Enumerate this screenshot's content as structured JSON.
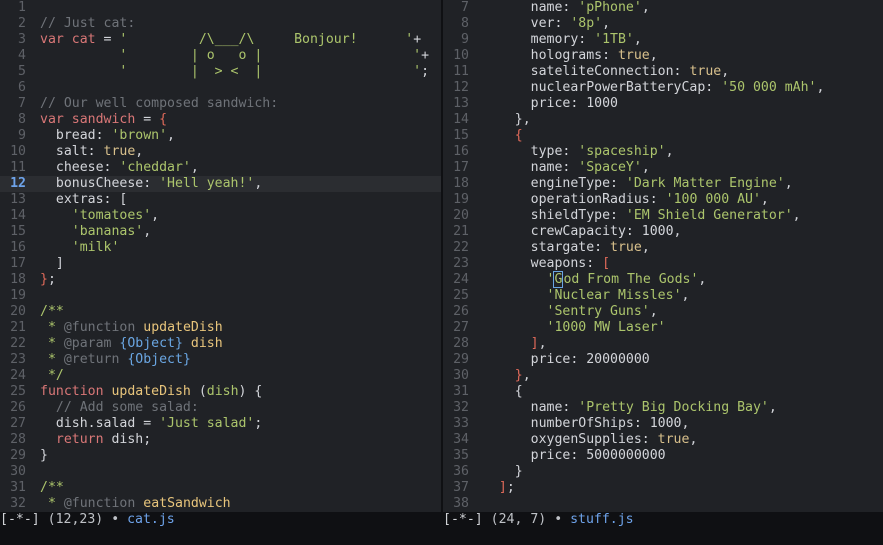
{
  "left_pane": {
    "lines": [
      {
        "n": "1",
        "parts": [
          {
            "t": ""
          }
        ]
      },
      {
        "n": "2",
        "parts": [
          {
            "t": "// Just cat:",
            "c": "c"
          }
        ]
      },
      {
        "n": "3",
        "parts": [
          {
            "t": "var ",
            "c": "k"
          },
          {
            "t": "cat",
            "c": "k"
          },
          {
            "t": " = "
          },
          {
            "t": "'         /\\___/\\     Bonjour!      '",
            "c": "s"
          },
          {
            "t": "+"
          }
        ]
      },
      {
        "n": "4",
        "parts": [
          {
            "t": "          "
          },
          {
            "t": "'        | o   o |                   '",
            "c": "s"
          },
          {
            "t": "+"
          }
        ]
      },
      {
        "n": "5",
        "parts": [
          {
            "t": "          "
          },
          {
            "t": "'        |  > <  |                   '",
            "c": "s"
          },
          {
            "t": ";"
          }
        ]
      },
      {
        "n": "6",
        "parts": [
          {
            "t": ""
          }
        ]
      },
      {
        "n": "7",
        "parts": [
          {
            "t": "// Our well composed sandwich:",
            "c": "c"
          }
        ]
      },
      {
        "n": "8",
        "parts": [
          {
            "t": "var ",
            "c": "k"
          },
          {
            "t": "sandwich",
            "c": "k"
          },
          {
            "t": " = "
          },
          {
            "t": "{",
            "c": "br"
          }
        ]
      },
      {
        "n": "9",
        "parts": [
          {
            "t": "  bread: "
          },
          {
            "t": "'brown'",
            "c": "s"
          },
          {
            "t": ","
          }
        ]
      },
      {
        "n": "10",
        "parts": [
          {
            "t": "  salt: "
          },
          {
            "t": "true",
            "c": "kw"
          },
          {
            "t": ","
          }
        ]
      },
      {
        "n": "11",
        "parts": [
          {
            "t": "  cheese: "
          },
          {
            "t": "'cheddar'",
            "c": "s"
          },
          {
            "t": ","
          }
        ]
      },
      {
        "n": "12",
        "cur": true,
        "parts": [
          {
            "t": "  bonusCheese: "
          },
          {
            "t": "'Hell yeah!'",
            "c": "s"
          },
          {
            "t": ","
          }
        ]
      },
      {
        "n": "13",
        "parts": [
          {
            "t": "  extras: ["
          }
        ]
      },
      {
        "n": "14",
        "parts": [
          {
            "t": "    "
          },
          {
            "t": "'tomatoes'",
            "c": "s"
          },
          {
            "t": ","
          }
        ]
      },
      {
        "n": "15",
        "parts": [
          {
            "t": "    "
          },
          {
            "t": "'bananas'",
            "c": "s"
          },
          {
            "t": ","
          }
        ]
      },
      {
        "n": "16",
        "parts": [
          {
            "t": "    "
          },
          {
            "t": "'milk'",
            "c": "s"
          }
        ]
      },
      {
        "n": "17",
        "parts": [
          {
            "t": "  ]"
          }
        ]
      },
      {
        "n": "18",
        "parts": [
          {
            "t": "}",
            "c": "br"
          },
          {
            "t": ";"
          }
        ]
      },
      {
        "n": "19",
        "parts": [
          {
            "t": ""
          }
        ]
      },
      {
        "n": "20",
        "parts": [
          {
            "t": "/**",
            "c": "doc"
          }
        ]
      },
      {
        "n": "21",
        "parts": [
          {
            "t": " * ",
            "c": "doc"
          },
          {
            "t": "@function",
            "c": "c"
          },
          {
            "t": " "
          },
          {
            "t": "updateDish",
            "c": "fn"
          }
        ]
      },
      {
        "n": "22",
        "parts": [
          {
            "t": " * ",
            "c": "doc"
          },
          {
            "t": "@param",
            "c": "c"
          },
          {
            "t": " "
          },
          {
            "t": "{Object}",
            "c": "ty"
          },
          {
            "t": " dish",
            "c": "fn"
          }
        ]
      },
      {
        "n": "23",
        "parts": [
          {
            "t": " * ",
            "c": "doc"
          },
          {
            "t": "@return",
            "c": "c"
          },
          {
            "t": " "
          },
          {
            "t": "{Object}",
            "c": "ty"
          }
        ]
      },
      {
        "n": "24",
        "parts": [
          {
            "t": " */",
            "c": "doc"
          }
        ]
      },
      {
        "n": "25",
        "parts": [
          {
            "t": "function ",
            "c": "k"
          },
          {
            "t": "updateDish",
            "c": "fn"
          },
          {
            "t": " ("
          },
          {
            "t": "dish",
            "c": "s"
          },
          {
            "t": ") {"
          }
        ]
      },
      {
        "n": "26",
        "parts": [
          {
            "t": "  // Add some salad:",
            "c": "c"
          }
        ]
      },
      {
        "n": "27",
        "parts": [
          {
            "t": "  dish.salad = "
          },
          {
            "t": "'Just salad'",
            "c": "s"
          },
          {
            "t": ";"
          }
        ]
      },
      {
        "n": "28",
        "parts": [
          {
            "t": "  "
          },
          {
            "t": "return",
            "c": "k"
          },
          {
            "t": " dish;"
          }
        ]
      },
      {
        "n": "29",
        "parts": [
          {
            "t": "}"
          }
        ]
      },
      {
        "n": "30",
        "parts": [
          {
            "t": ""
          }
        ]
      },
      {
        "n": "31",
        "parts": [
          {
            "t": "/**",
            "c": "doc"
          }
        ]
      },
      {
        "n": "32",
        "parts": [
          {
            "t": " * ",
            "c": "doc"
          },
          {
            "t": "@function",
            "c": "c"
          },
          {
            "t": " "
          },
          {
            "t": "eatSandwich",
            "c": "fn"
          }
        ]
      }
    ]
  },
  "right_pane": {
    "lines": [
      {
        "n": "7",
        "parts": [
          {
            "t": "      name: "
          },
          {
            "t": "'pPhone'",
            "c": "s"
          },
          {
            "t": ","
          }
        ]
      },
      {
        "n": "8",
        "parts": [
          {
            "t": "      ver: "
          },
          {
            "t": "'8p'",
            "c": "s"
          },
          {
            "t": ","
          }
        ]
      },
      {
        "n": "9",
        "parts": [
          {
            "t": "      memory: "
          },
          {
            "t": "'1TB'",
            "c": "s"
          },
          {
            "t": ","
          }
        ]
      },
      {
        "n": "10",
        "parts": [
          {
            "t": "      holograms: "
          },
          {
            "t": "true",
            "c": "kw"
          },
          {
            "t": ","
          }
        ]
      },
      {
        "n": "11",
        "parts": [
          {
            "t": "      sateliteConnection: "
          },
          {
            "t": "true",
            "c": "kw"
          },
          {
            "t": ","
          }
        ]
      },
      {
        "n": "12",
        "parts": [
          {
            "t": "      nuclearPowerBatteryCap: "
          },
          {
            "t": "'50 000 mAh'",
            "c": "s"
          },
          {
            "t": ","
          }
        ]
      },
      {
        "n": "13",
        "parts": [
          {
            "t": "      price: 1000"
          }
        ]
      },
      {
        "n": "14",
        "parts": [
          {
            "t": "    },"
          }
        ]
      },
      {
        "n": "15",
        "parts": [
          {
            "t": "    "
          },
          {
            "t": "{",
            "c": "br"
          }
        ]
      },
      {
        "n": "16",
        "parts": [
          {
            "t": "      type: "
          },
          {
            "t": "'spaceship'",
            "c": "s"
          },
          {
            "t": ","
          }
        ]
      },
      {
        "n": "17",
        "parts": [
          {
            "t": "      name: "
          },
          {
            "t": "'SpaceY'",
            "c": "s"
          },
          {
            "t": ","
          }
        ]
      },
      {
        "n": "18",
        "parts": [
          {
            "t": "      engineType: "
          },
          {
            "t": "'Dark Matter Engine'",
            "c": "s"
          },
          {
            "t": ","
          }
        ]
      },
      {
        "n": "19",
        "parts": [
          {
            "t": "      operationRadius: "
          },
          {
            "t": "'100 000 AU'",
            "c": "s"
          },
          {
            "t": ","
          }
        ]
      },
      {
        "n": "20",
        "parts": [
          {
            "t": "      shieldType: "
          },
          {
            "t": "'EM Shield Generator'",
            "c": "s"
          },
          {
            "t": ","
          }
        ]
      },
      {
        "n": "21",
        "parts": [
          {
            "t": "      crewCapacity: 1000,"
          }
        ]
      },
      {
        "n": "22",
        "parts": [
          {
            "t": "      stargate: "
          },
          {
            "t": "true",
            "c": "kw"
          },
          {
            "t": ","
          }
        ]
      },
      {
        "n": "23",
        "parts": [
          {
            "t": "      weapons: "
          },
          {
            "t": "[",
            "c": "br"
          }
        ]
      },
      {
        "n": "24",
        "parts": [
          {
            "t": "        "
          },
          {
            "t": "'",
            "c": "s"
          },
          {
            "t": "G",
            "c": "cursor s"
          },
          {
            "t": "od From The Gods'",
            "c": "s"
          },
          {
            "t": ","
          }
        ]
      },
      {
        "n": "25",
        "parts": [
          {
            "t": "        "
          },
          {
            "t": "'Nuclear Missles'",
            "c": "s"
          },
          {
            "t": ","
          }
        ]
      },
      {
        "n": "26",
        "parts": [
          {
            "t": "        "
          },
          {
            "t": "'Sentry Guns'",
            "c": "s"
          },
          {
            "t": ","
          }
        ]
      },
      {
        "n": "27",
        "parts": [
          {
            "t": "        "
          },
          {
            "t": "'1000 MW Laser'",
            "c": "s"
          }
        ]
      },
      {
        "n": "28",
        "parts": [
          {
            "t": "      "
          },
          {
            "t": "]",
            "c": "br"
          },
          {
            "t": ","
          }
        ]
      },
      {
        "n": "29",
        "parts": [
          {
            "t": "      price: 20000000"
          }
        ]
      },
      {
        "n": "30",
        "parts": [
          {
            "t": "    "
          },
          {
            "t": "}",
            "c": "br"
          },
          {
            "t": ","
          }
        ]
      },
      {
        "n": "31",
        "parts": [
          {
            "t": "    {"
          }
        ]
      },
      {
        "n": "32",
        "parts": [
          {
            "t": "      name: "
          },
          {
            "t": "'Pretty Big Docking Bay'",
            "c": "s"
          },
          {
            "t": ","
          }
        ]
      },
      {
        "n": "33",
        "parts": [
          {
            "t": "      numberOfShips: 1000,"
          }
        ]
      },
      {
        "n": "34",
        "parts": [
          {
            "t": "      oxygenSupplies: "
          },
          {
            "t": "true",
            "c": "kw"
          },
          {
            "t": ","
          }
        ]
      },
      {
        "n": "35",
        "parts": [
          {
            "t": "      price: 5000000000"
          }
        ]
      },
      {
        "n": "36",
        "parts": [
          {
            "t": "    }"
          }
        ]
      },
      {
        "n": "37",
        "parts": [
          {
            "t": "  "
          },
          {
            "t": "]",
            "c": "br"
          },
          {
            "t": ";"
          }
        ]
      },
      {
        "n": "38",
        "parts": [
          {
            "t": ""
          }
        ]
      }
    ]
  },
  "status_left": {
    "mode": "[-*-]",
    "pos": "(12,23)",
    "sep": "•",
    "file": "cat.js"
  },
  "status_right": {
    "mode": "[-*-]",
    "pos": "(24, 7)",
    "sep": "•",
    "file": "stuff.js"
  }
}
